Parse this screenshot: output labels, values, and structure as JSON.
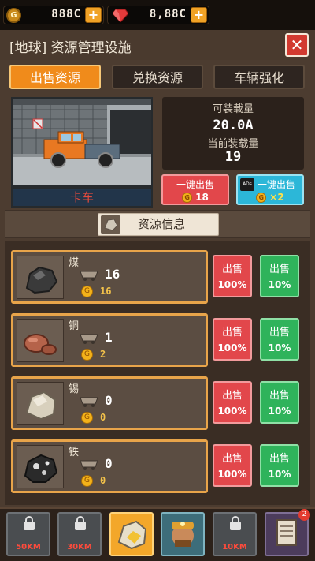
{
  "currency": {
    "gold": "888C",
    "gems": "8,88C",
    "coin_symbol": "G",
    "plus_label": "+"
  },
  "header": {
    "title": "[地球] 资源管理设施",
    "close_label": "✕"
  },
  "tabs": [
    {
      "label": "出售资源",
      "active": true
    },
    {
      "label": "兑换资源",
      "active": false
    },
    {
      "label": "车辆强化",
      "active": false
    }
  ],
  "vehicle": {
    "name": "卡车",
    "capacity_label": "可装载量",
    "capacity_value": "20.0A",
    "current_label": "当前装载量",
    "current_value": "19"
  },
  "sell_all": {
    "normal_label": "一键出售",
    "normal_value": "18",
    "ad_label": "一键出售",
    "ad_icon_text": "ADs",
    "ad_value": "×2"
  },
  "info_button": "资源信息",
  "resources": [
    {
      "name": "煤",
      "qty": "16",
      "gold": "16",
      "sell_a": "出售",
      "pct_a": "100%",
      "sell_b": "出售",
      "pct_b": "10%"
    },
    {
      "name": "铜",
      "qty": "1",
      "gold": "2",
      "sell_a": "出售",
      "pct_a": "100%",
      "sell_b": "出售",
      "pct_b": "10%"
    },
    {
      "name": "锡",
      "qty": "0",
      "gold": "0",
      "sell_a": "出售",
      "pct_a": "100%",
      "sell_b": "出售",
      "pct_b": "10%"
    },
    {
      "name": "铁",
      "qty": "0",
      "gold": "0",
      "sell_a": "出售",
      "pct_a": "100%",
      "sell_b": "出售",
      "pct_b": "10%"
    }
  ],
  "bottom_nav": [
    {
      "label": "50KM",
      "locked": true
    },
    {
      "label": "30KM",
      "locked": true
    },
    {
      "label": "",
      "selected": true
    },
    {
      "label": "",
      "hero": true
    },
    {
      "label": "10KM",
      "locked": true
    },
    {
      "label": "",
      "badge": "2"
    }
  ],
  "colors": {
    "accent_orange": "#f08b1b",
    "sell_red": "#e2474b",
    "sell_green": "#2fb35b",
    "ad_cyan": "#2cb7d8"
  }
}
